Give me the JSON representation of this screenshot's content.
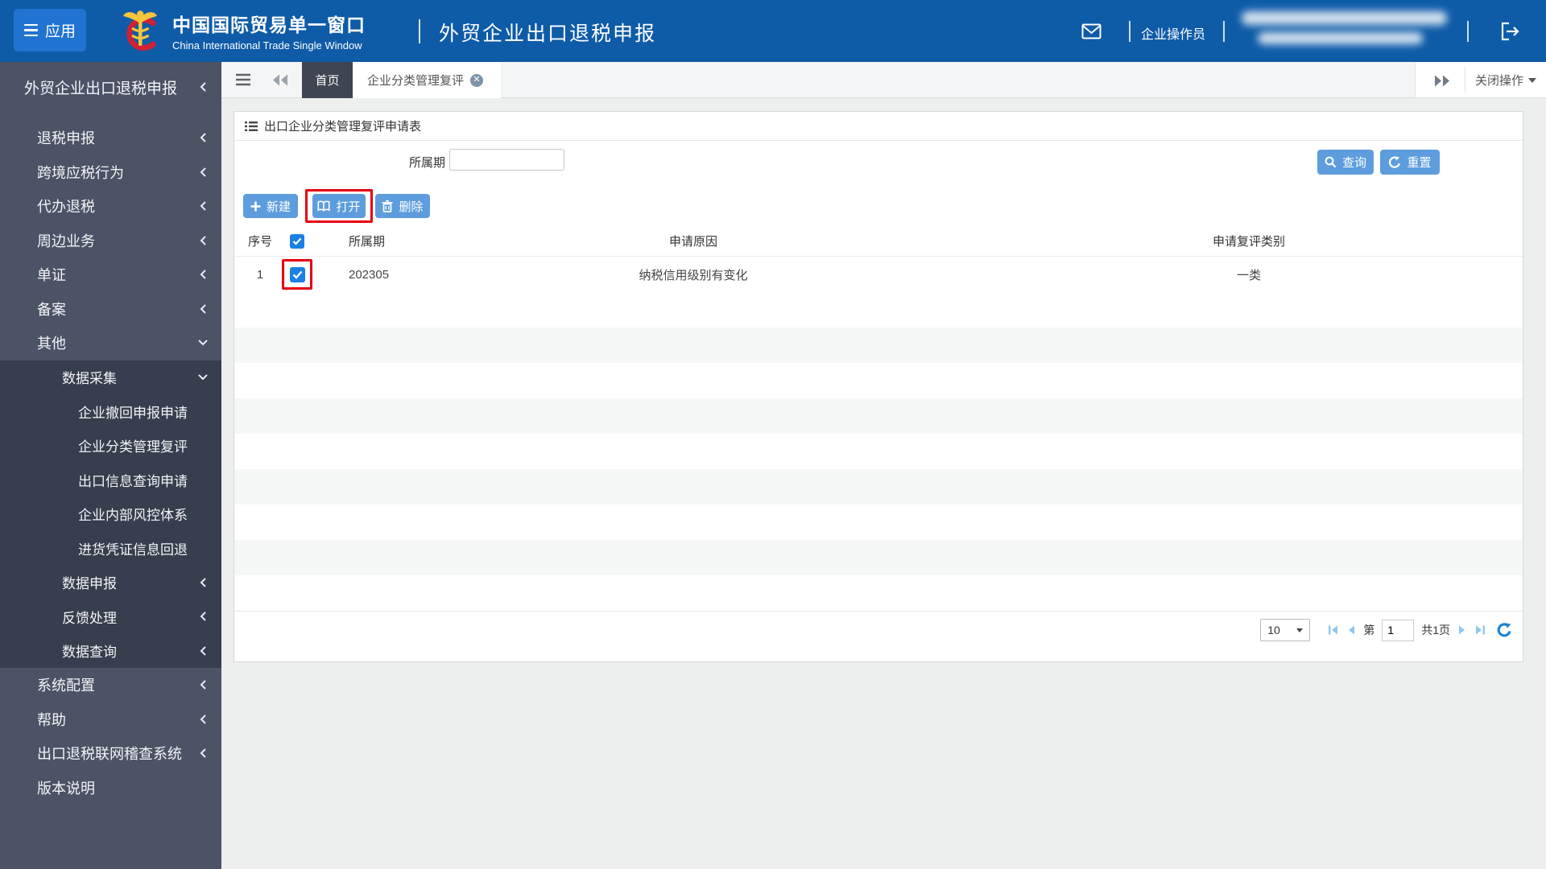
{
  "colors": {
    "header_blue": "#0e5ba8",
    "app_button_blue": "#2173d2",
    "primary_button_blue": "#5d9ddd",
    "sidebar_bg": "#4c5365",
    "sidebar_submenu_bg": "#373e4d",
    "home_tab_bg": "#3f4552",
    "annotation_red": "#e60012",
    "checkbox_blue": "#1b7fe4",
    "pagination_arrow_blue": "#8ec6f0",
    "refresh_blue": "#1b83d2"
  },
  "header": {
    "apps_label": "应用",
    "brand_title": "中国国际贸易单一窗口",
    "brand_subtitle": "China International Trade Single Window",
    "module_title": "外贸企业出口退税申报",
    "user_role": "企业操作员"
  },
  "tabbar": {
    "home_tab": "首页",
    "active_tab": "企业分类管理复评",
    "close_menu_label": "关闭操作"
  },
  "sidebar": {
    "title": "外贸企业出口退税申报",
    "items": [
      {
        "label": "退税申报",
        "level": 1,
        "chevron": "left"
      },
      {
        "label": "跨境应税行为",
        "level": 1,
        "chevron": "left"
      },
      {
        "label": "代办退税",
        "level": 1,
        "chevron": "left"
      },
      {
        "label": "周边业务",
        "level": 1,
        "chevron": "left"
      },
      {
        "label": "单证",
        "level": 1,
        "chevron": "left"
      },
      {
        "label": "备案",
        "level": 1,
        "chevron": "left"
      },
      {
        "label": "其他",
        "level": 1,
        "chevron": "down"
      },
      {
        "label": "数据采集",
        "level": 2,
        "chevron": "down",
        "sub": true
      },
      {
        "label": "企业撤回申报申请",
        "level": 3,
        "sub": true
      },
      {
        "label": "企业分类管理复评",
        "level": 3,
        "sub": true
      },
      {
        "label": "出口信息查询申请",
        "level": 3,
        "sub": true
      },
      {
        "label": "企业内部风控体系",
        "level": 3,
        "sub": true
      },
      {
        "label": "进货凭证信息回退",
        "level": 3,
        "sub": true
      },
      {
        "label": "数据申报",
        "level": 2,
        "chevron": "left",
        "sub": true
      },
      {
        "label": "反馈处理",
        "level": 2,
        "chevron": "left",
        "sub": true
      },
      {
        "label": "数据查询",
        "level": 2,
        "chevron": "left",
        "sub": true
      },
      {
        "label": "系统配置",
        "level": 1,
        "chevron": "left"
      },
      {
        "label": "帮助",
        "level": 1,
        "chevron": "left"
      },
      {
        "label": "出口退税联网稽查系统",
        "level": 1,
        "chevron": "left"
      },
      {
        "label": "版本说明",
        "level": 1
      }
    ]
  },
  "main": {
    "panel_title": "出口企业分类管理复评申请表",
    "filter_label": "所属期",
    "filter_value": "",
    "query_button": "查询",
    "reset_button": "重置",
    "new_button": "新建",
    "open_button": "打开",
    "delete_button": "删除",
    "table": {
      "headers": {
        "index": "序号",
        "period": "所属期",
        "reason": "申请原因",
        "category": "申请复评类别"
      },
      "rows": [
        {
          "index": "1",
          "period": "202305",
          "reason": "纳税信用级别有变化",
          "category": "一类",
          "checked": true
        }
      ]
    },
    "pagination": {
      "page_size": "10",
      "page_prefix": "第",
      "page_value": "1",
      "total_pages": "共1页"
    }
  }
}
